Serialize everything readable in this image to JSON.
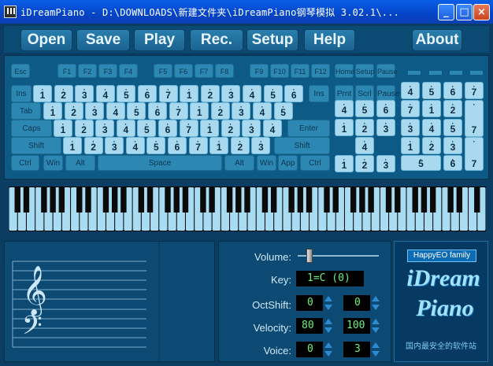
{
  "window": {
    "title": "iDreamPiano - D:\\DOWNLOADS\\新建文件夹\\iDreamPiano钢琴模拟 3.02.1\\...",
    "minimize": "_",
    "maximize": "□",
    "close": "×"
  },
  "menu": [
    "Open",
    "Save",
    "Play",
    "Rec.",
    "Setup",
    "Help",
    "About"
  ],
  "keyboard": {
    "row0": [
      "Esc",
      "F1",
      "F2",
      "F3",
      "F4",
      "F5",
      "F6",
      "F7",
      "F8",
      "F9",
      "F10",
      "F11",
      "F12",
      "Home",
      "Setup",
      "Pause"
    ],
    "row1_notes": [
      "1",
      "2",
      "3",
      "4",
      "5",
      "6",
      "7",
      "1",
      "2",
      "3",
      "4",
      "5",
      "6"
    ],
    "row1_nav": [
      "Ins",
      "Prnt",
      "Scrl",
      "Pause"
    ],
    "row2_left": "Tab",
    "row2_notes": [
      "1",
      "2",
      "3",
      "4",
      "5",
      "6",
      "7",
      "1",
      "2",
      "3",
      "4",
      "5"
    ],
    "row3_left": "Caps",
    "row3_notes": [
      "1",
      "2",
      "3",
      "4",
      "5",
      "6",
      "7",
      "1",
      "2",
      "3",
      "4"
    ],
    "row3_right": "Enter",
    "row4_left": "Shift",
    "row4_notes": [
      "1",
      "2",
      "3",
      "4",
      "5",
      "6",
      "7",
      "1",
      "2",
      "3"
    ],
    "row4_right": "Shift",
    "row5": [
      "Ctrl",
      "Win",
      "Alt",
      "Space",
      "Alt",
      "Win",
      "App",
      "Ctrl"
    ],
    "nav_notes": [
      "4",
      "5",
      "6",
      "1",
      "2",
      "3",
      "4",
      "1",
      "2",
      "3"
    ],
    "numpad": [
      "4",
      "5",
      "6",
      "7",
      "7",
      "1",
      "2",
      "3",
      "4",
      "5",
      "6",
      "1",
      "2",
      "3",
      "7",
      "5",
      "6"
    ]
  },
  "controls": {
    "volume_label": "Volume:",
    "volume_level": 0.12,
    "key_label": "Key:",
    "key_value": "1=C  (0)",
    "octshift_label": "OctShift:",
    "octshift_left": "0",
    "octshift_right": "0",
    "velocity_label": "Velocity:",
    "velocity_left": "80",
    "velocity_right": "100",
    "voice_label": "Voice:",
    "voice_left": "0",
    "voice_right": "3"
  },
  "logo": {
    "badge": "HappyEO family",
    "line1": "iDream",
    "line2": "Piano",
    "footer": "国内最安全的软件站"
  },
  "colors": {
    "accent": "#2c88b2",
    "key_light": "#a9d9ee",
    "lcd_text": "#6df07f",
    "title_blue": "#0544c8"
  }
}
